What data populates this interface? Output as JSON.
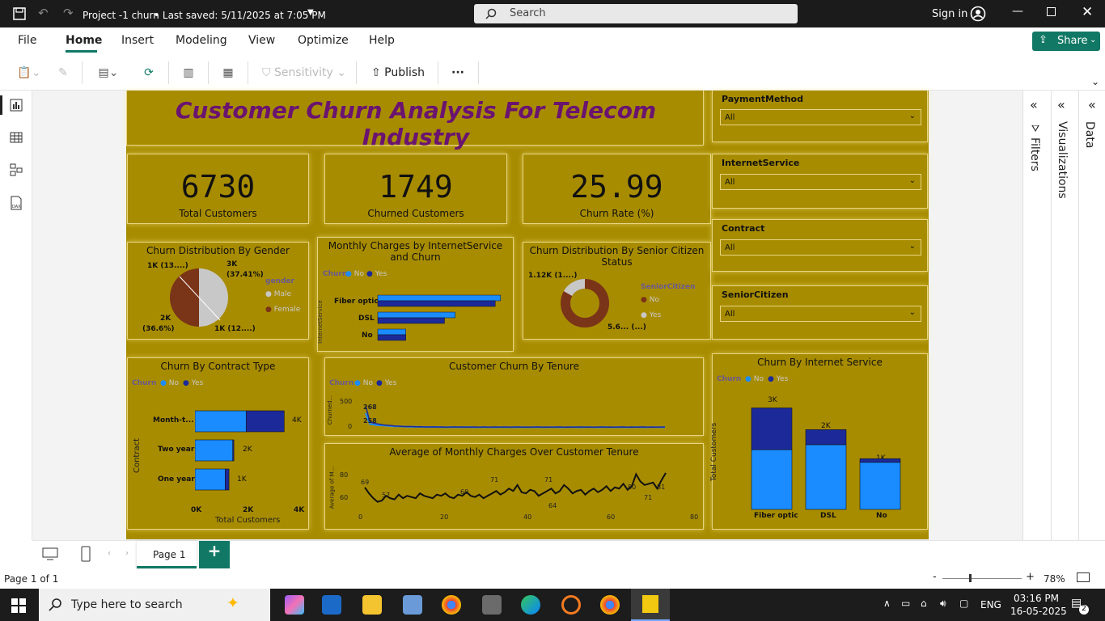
{
  "app": {
    "title": "Project -1 churn",
    "saved": "• Last saved: 5/11/2025 at 7:05 PM",
    "search_placeholder": "Search",
    "signin": "Sign in"
  },
  "menu": {
    "file": "File",
    "home": "Home",
    "insert": "Insert",
    "modeling": "Modeling",
    "view": "View",
    "optimize": "Optimize",
    "help": "Help",
    "share": "Share"
  },
  "ribbon": {
    "sensitivity": "Sensitivity",
    "publish": "Publish",
    "more": "···"
  },
  "report": {
    "title": "Customer Churn Analysis For Telecom Industry",
    "kpis": [
      {
        "value": "6730",
        "label": "Total Customers"
      },
      {
        "value": "1749",
        "label": "Churned Customers"
      },
      {
        "value": "25.99",
        "label": "Churn Rate (%)"
      }
    ],
    "gender": {
      "title": "Churn Distribution By Gender",
      "legend_title": "gender",
      "legend": [
        "Male",
        "Female"
      ],
      "labels": [
        "1K (13....)",
        "3K",
        "(37.41%)",
        "2K",
        "(36.6%)",
        "1K (12....)"
      ]
    },
    "monthly": {
      "title": "Monthly Charges by InternetService and Churn",
      "legend_title": "Churn",
      "legend": [
        "No",
        "Yes"
      ],
      "axis": "InternetService",
      "categories": [
        "Fiber optic",
        "DSL",
        "No"
      ]
    },
    "senior": {
      "title": "Churn Distribution By Senior Citizen Status",
      "legend_title": "SeniorCitizen",
      "legend": [
        "No",
        "Yes"
      ],
      "labels": [
        "1.12K (1....)",
        "5.6... (...)"
      ]
    },
    "contract": {
      "title": "Churn By Contract Type",
      "legend_title": "Churn",
      "legend": [
        "No",
        "Yes"
      ],
      "ylabel": "Contract",
      "xlabel": "Total Customers",
      "categories": [
        "Month-t...",
        "Two year",
        "One year"
      ],
      "values": [
        "4K",
        "2K",
        "1K"
      ],
      "ticks": [
        "0K",
        "2K",
        "4K"
      ]
    },
    "tenure": {
      "title": "Customer Churn By Tenure",
      "legend_title": "Churn",
      "legend": [
        "No",
        "Yes"
      ],
      "ylabel": "Churned...",
      "yticks": [
        "500",
        "0"
      ],
      "labels": [
        "268",
        "258"
      ]
    },
    "avgcharges": {
      "title": "Average of Monthly Charges Over Customer Tenure",
      "ylabel": "Average of M...",
      "yticks": [
        "80",
        "60"
      ],
      "xticks": [
        "0",
        "20",
        "40",
        "60",
        "80"
      ],
      "labels": [
        "69",
        "57",
        "60",
        "71",
        "71",
        "64",
        "80",
        "71",
        "81"
      ]
    },
    "internet": {
      "title": "Churn By Internet Service",
      "legend_title": "Churn",
      "legend": [
        "No",
        "Yes"
      ],
      "ylabel": "Total Customers",
      "categories": [
        "Fiber optic",
        "DSL",
        "No"
      ],
      "values": [
        "3K",
        "2K",
        "1K"
      ]
    },
    "slicers": [
      {
        "title": "PaymentMethod",
        "value": "All"
      },
      {
        "title": "InternetService",
        "value": "All"
      },
      {
        "title": "Contract",
        "value": "All"
      },
      {
        "title": "SeniorCitizen",
        "value": "All"
      }
    ]
  },
  "panes": {
    "filters": "Filters",
    "visualizations": "Visualizations",
    "data": "Data"
  },
  "pages": {
    "tab": "Page 1",
    "status": "Page 1 of 1",
    "zoom": "78%"
  },
  "taskbar": {
    "search": "Type here to search",
    "lang": "ENG",
    "time": "03:16 PM",
    "date": "16-05-2025",
    "notif": "2"
  },
  "colors": {
    "report_bg": "#a88c00",
    "title": "#6a1470",
    "no": "#1a8cff",
    "yes": "#1c2a99",
    "female": "#7a3418",
    "male": "#c8c8c8"
  },
  "chart_data": [
    {
      "type": "bar",
      "title": "Churn By Contract Type",
      "categories": [
        "Month-t...",
        "Two year",
        "One year"
      ],
      "series": [
        {
          "name": "No",
          "values": [
            2220,
            1640,
            1310
          ]
        },
        {
          "name": "Yes",
          "values": [
            1650,
            48,
            166
          ]
        }
      ]
    },
    {
      "type": "bar",
      "title": "Churn By Internet Service",
      "categories": [
        "Fiber optic",
        "DSL",
        "No"
      ],
      "series": [
        {
          "name": "No",
          "values": [
            1790,
            1940,
            1410
          ]
        },
        {
          "name": "Yes",
          "values": [
            1250,
            450,
            110
          ]
        }
      ]
    },
    {
      "type": "bar",
      "title": "Monthly Charges by InternetService and Churn",
      "categories": [
        "Fiber optic",
        "DSL",
        "No"
      ],
      "series": [
        {
          "name": "No",
          "values": [
            92,
            58,
            21
          ]
        },
        {
          "name": "Yes",
          "values": [
            88,
            50,
            21
          ]
        }
      ]
    },
    {
      "type": "pie",
      "title": "Churn Distribution By Gender",
      "legend": [
        "Male",
        "Female"
      ]
    },
    {
      "type": "pie",
      "title": "Churn Distribution By Senior Citizen Status",
      "legend": [
        "No",
        "Yes"
      ]
    },
    {
      "type": "line",
      "title": "Customer Churn By Tenure",
      "ylim": [
        0,
        500
      ]
    },
    {
      "type": "line",
      "title": "Average of Monthly Charges Over Customer Tenure",
      "xlim": [
        0,
        80
      ],
      "ylim": [
        50,
        85
      ]
    }
  ]
}
